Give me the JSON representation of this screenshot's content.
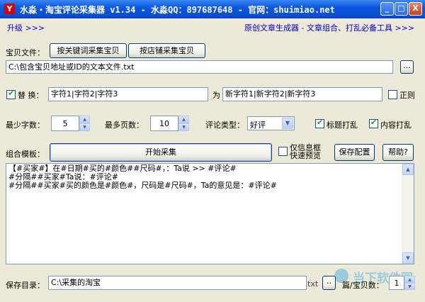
{
  "window": {
    "title": "水淼・淘宝评论采集器 v1.34 - 水淼QQ：897687648 - 官网：shuimiao.net",
    "icon_char": "Y",
    "min_label": "_",
    "max_label": "□",
    "close_label": "X"
  },
  "links": {
    "upgrade": "升级 >>>",
    "generator": "原创文章生成器 - 文章组合、打乱必备工具 >>>"
  },
  "baobei_file": {
    "label": "宝贝文件：",
    "keyword_button": "按关键词采集宝贝",
    "shop_button": "按店铺采集宝贝",
    "path": "C:\\包含宝贝地址或ID的文本文件.txt",
    "browse_button": "..."
  },
  "replace": {
    "checked": true,
    "label": "替  换：",
    "from_value": "字符1|字符2|字符3",
    "to_label": "为",
    "to_value": "新字符1|新字符2|新字符3",
    "regex_label": "正则",
    "regex_checked": false
  },
  "options": {
    "min_chars_label": "最少字数：",
    "min_chars_value": "5",
    "max_pages_label": "最多页数：",
    "max_pages_value": "10",
    "comment_type_label": "评论类型：",
    "comment_type_value": "好评",
    "title_shuffle_label": "标题打乱",
    "title_shuffle_checked": true,
    "content_shuffle_label": "内容打乱",
    "content_shuffle_checked": true
  },
  "template": {
    "label": "组合模板：",
    "start_button": "开始采集",
    "info_only_label_line1": "仅信息框",
    "info_only_label_line2": "快速预览",
    "info_only_checked": false,
    "save_config_button": "保存配置",
    "help_button": "帮助?",
    "lines": [
      "【#买家#】在#日期#买的#颜色##尺码#，：Ta说 >> #评论#",
      "#分隔##买家#Ta说：#评论#",
      "#分隔##买家#买的颜色是#颜色#，尺码是#尺码#，Ta的意见是：#评论#"
    ]
  },
  "save": {
    "label": "保存目录：",
    "path": "C:\\采集的淘宝",
    "ext_label": "txt",
    "browse_button": "..",
    "per_file_label": "篇/宝贝数：",
    "per_file_value": "1"
  },
  "watermark": {
    "text": "当下软件园"
  }
}
